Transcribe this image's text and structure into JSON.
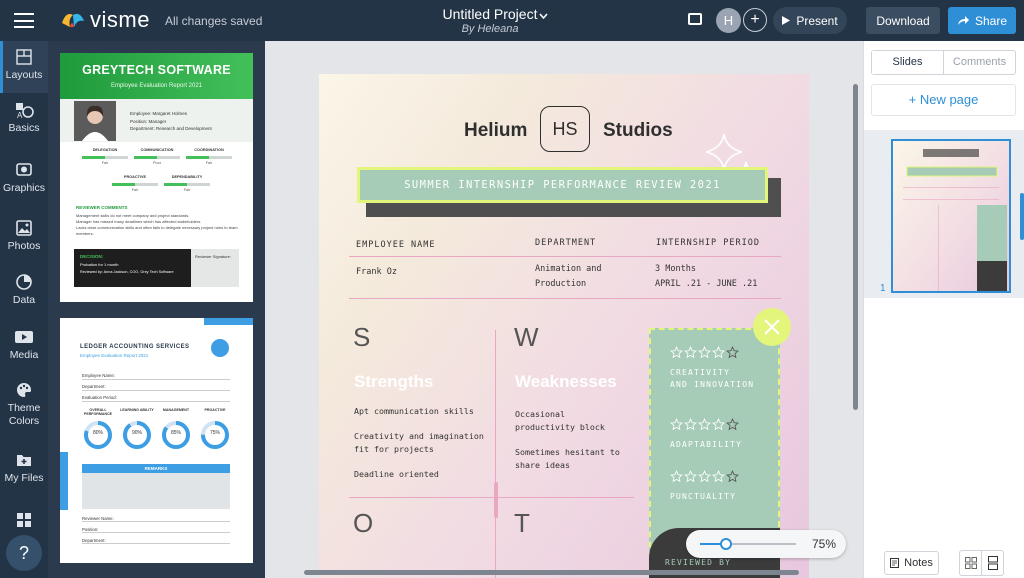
{
  "topbar": {
    "brand": "visme",
    "save_status": "All changes saved",
    "project_title": "Untitled Project",
    "project_author": "By Heleana",
    "avatar_initial": "H",
    "present_label": "Present",
    "download_label": "Download",
    "share_label": "Share"
  },
  "sidebar": {
    "items": [
      {
        "label": "Layouts",
        "icon": "layouts-icon"
      },
      {
        "label": "Basics",
        "icon": "basics-icon"
      },
      {
        "label": "Graphics",
        "icon": "graphics-icon"
      },
      {
        "label": "Photos",
        "icon": "photos-icon"
      },
      {
        "label": "Data",
        "icon": "data-pie-icon"
      },
      {
        "label": "Media",
        "icon": "media-play-icon"
      },
      {
        "label": "Theme Colors",
        "icon": "palette-icon"
      },
      {
        "label": "My Files",
        "icon": "folder-icon"
      },
      {
        "label": "Apps",
        "icon": "apps-grid-icon"
      }
    ],
    "help_label": "?"
  },
  "templates": {
    "t1": {
      "title": "GREYTECH SOFTWARE",
      "subtitle": "Employee Evaluation Report 2021",
      "employee": "Employee: Margaret Holmes",
      "position": "Position: Manager",
      "department": "Department: Research and Development",
      "metrics": [
        "DELEGATION",
        "COMMUNICATION",
        "COORDINATION",
        "PROACTIVE",
        "DEPENDABILITY"
      ],
      "metric_ratings": [
        "Fair",
        "Poor",
        "Fair",
        "Fair",
        "Fair"
      ],
      "comments_title": "REVIEWER COMMENTS",
      "comments": [
        "Management skills do not meet company and project standards.",
        "Manager has missed many deadlines which has affected stakeholders.",
        "Lacks clear communication skills and often fails to delegate necessary project roles to team members."
      ],
      "decision_title": "DECISION:",
      "decision_text": "Probation for 1 month",
      "reviewed_by": "Reviewed by: Anna Jackson, COO, Grey Tech Software",
      "signature": "Reviewer Signature:"
    },
    "t2": {
      "title": "LEDGER ACCOUNTING SERVICES",
      "subtitle": "Employee Evaluation Report 2021",
      "fields": [
        "Employee Name:",
        "Department:",
        "Evaluation Period:"
      ],
      "metrics": [
        "OVERALL PERFORMANCE",
        "LEARNING ABILITY",
        "MANAGEMENT",
        "PROACTIVE"
      ],
      "metric_values": [
        "80%",
        "90%",
        "85%",
        "75%"
      ],
      "metric_fractions": [
        0.8,
        0.9,
        0.85,
        0.75
      ],
      "remarks": "REMARKS",
      "footer_fields": [
        "Reviewer Name:",
        "Position:",
        "Department:"
      ]
    }
  },
  "doc": {
    "brand_left": "Helium",
    "brand_mark": "HS",
    "brand_right": "Studios",
    "banner": "SUMMER INTERNSHIP PERFORMANCE REVIEW 2021",
    "headers": [
      "EMPLOYEE NAME",
      "DEPARTMENT",
      "INTERNSHIP PERIOD"
    ],
    "employee_name": "Frank Oz",
    "department_line1": "Animation and",
    "department_line2": "Production",
    "period_line1": "3 Months",
    "period_line2": "APRIL .21 - JUNE .21",
    "s_letter": "S",
    "w_letter": "W",
    "o_letter": "O",
    "t_letter": "T",
    "strengths_title": "Strengths",
    "strengths": [
      "Apt communication skills",
      "Creativity and imagination",
      "fit for projects",
      "Deadline oriented"
    ],
    "weaknesses_title": "Weaknesses",
    "weaknesses": [
      "Occasional",
      "productivity block",
      "Sometimes hesitant to",
      "share ideas"
    ],
    "ratings": [
      {
        "line1": "CREATIVITY",
        "line2": "AND INNOVATION",
        "stars": 4
      },
      {
        "line1": "ADAPTABILITY",
        "line2": "",
        "stars": 4
      },
      {
        "line1": "PUNCTUALITY",
        "line2": "",
        "stars": 4
      }
    ],
    "reviewed_by": "REVIEWED BY"
  },
  "zoom": {
    "label": "75%",
    "level": 0.75
  },
  "rightpanel": {
    "tab_slides": "Slides",
    "tab_comments": "Comments",
    "new_page": "+ New page",
    "slide_number": "1",
    "notes_label": "Notes"
  },
  "colors": {
    "accent": "#2e8fd6",
    "topbar": "#243447",
    "green": "#2fb34a",
    "sage": "#a6cbb6",
    "lime": "#e3f57a"
  }
}
